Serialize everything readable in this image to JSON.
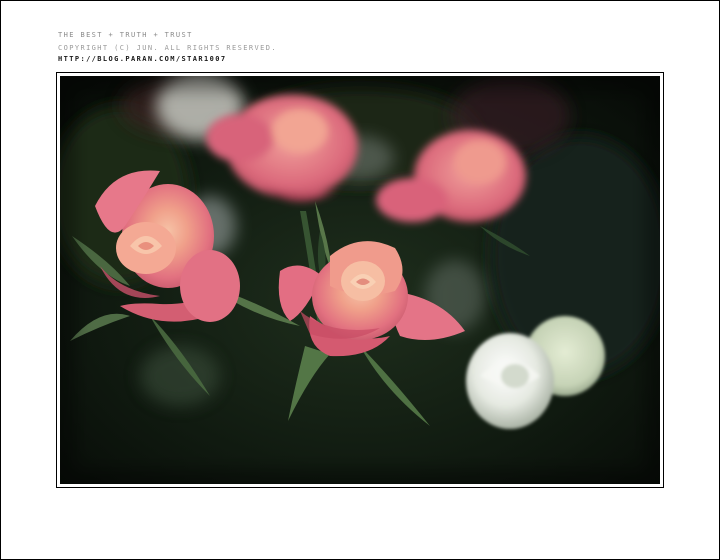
{
  "caption": {
    "line1": "THE BEST + TRUTH + TRUST",
    "line2": "COPYRIGHT (C) JUN. ALL RIGHTS RESERVED.",
    "line3": "HTTP://BLOG.PARAN.COM/STAR1007"
  },
  "photo": {
    "subject": "pink and white roses on dark green foliage",
    "colors": {
      "background": "#0c130d",
      "rose_pink": "#e47a86",
      "rose_center": "#f4b39a",
      "white_rose": "#e9ece6",
      "leaf_green": "#2c4a2c"
    }
  }
}
